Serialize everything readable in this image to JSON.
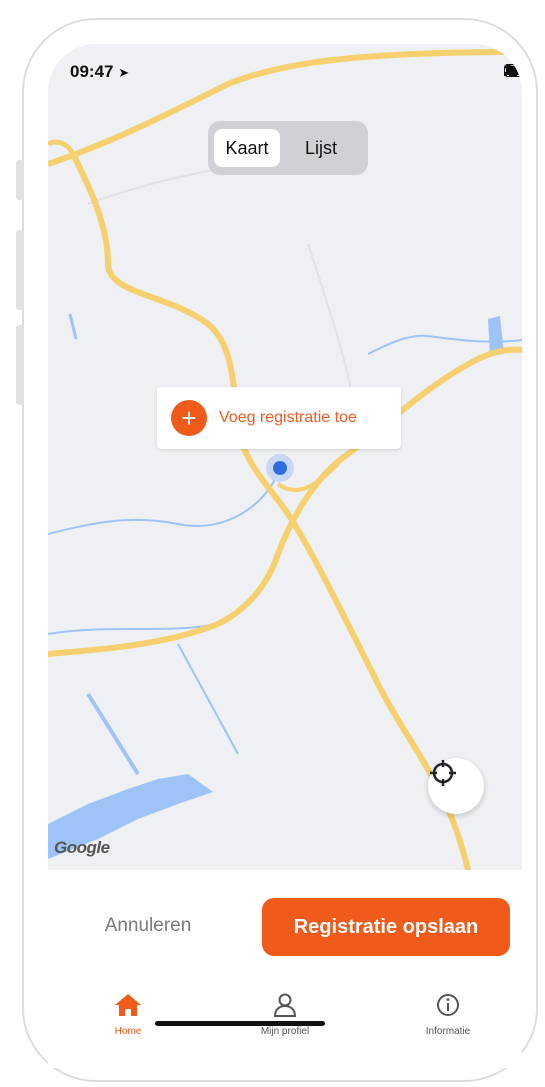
{
  "status_bar": {
    "time": "09:47",
    "location_glyph": "➤"
  },
  "view_toggle": {
    "options": [
      "Kaart",
      "Lijst"
    ],
    "selected": "Kaart"
  },
  "map": {
    "add_registration_label": "Voeg registratie toe",
    "add_icon": "plus-icon",
    "locate_icon": "crosshair-icon",
    "attribution": "Google"
  },
  "actions": {
    "cancel_label": "Annuleren",
    "save_label": "Registratie opslaan"
  },
  "tabbar": {
    "items": [
      {
        "label": "Home",
        "icon": "home-icon",
        "active": true
      },
      {
        "label": "Mijn profiel",
        "icon": "user-icon",
        "active": false
      },
      {
        "label": "Informatie",
        "icon": "info-icon",
        "active": false
      }
    ]
  },
  "colors": {
    "accent": "#f05a1a",
    "road": "#f6cf6e",
    "water": "#9ec3f7",
    "map_bg": "#eef0f3"
  }
}
